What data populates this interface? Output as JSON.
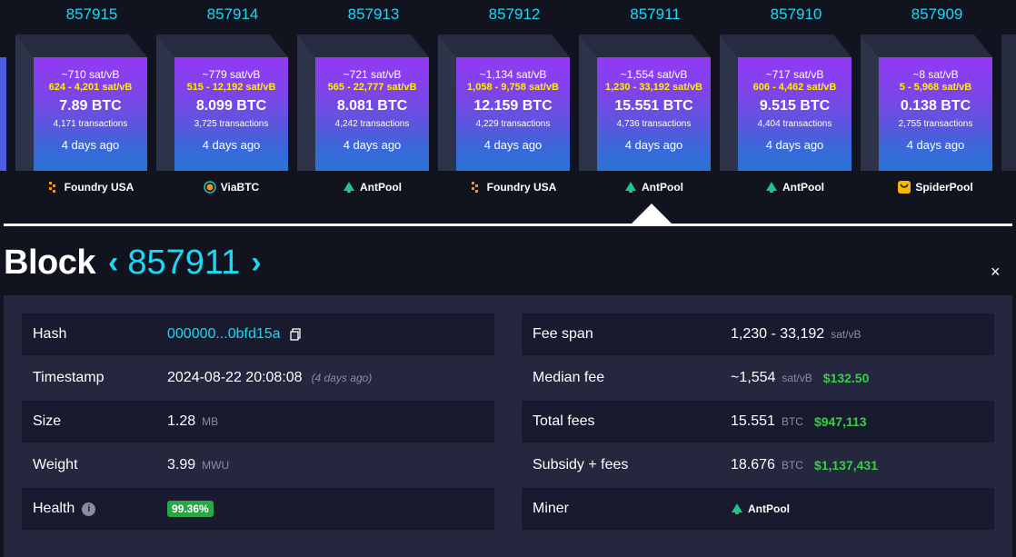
{
  "blocks": [
    {
      "height": "857915",
      "avg_fee": "~710 sat/vB",
      "fee_range": "624 - 4,201 sat/vB",
      "reward": "7.89 BTC",
      "tx_count": "4,171 transactions",
      "time_ago": "4 days ago",
      "miner": "Foundry USA",
      "miner_icon": "foundry-icon"
    },
    {
      "height": "857914",
      "avg_fee": "~779 sat/vB",
      "fee_range": "515 - 12,192 sat/vB",
      "reward": "8.099 BTC",
      "tx_count": "3,725 transactions",
      "time_ago": "4 days ago",
      "miner": "ViaBTC",
      "miner_icon": "viabtc-icon"
    },
    {
      "height": "857913",
      "avg_fee": "~721 sat/vB",
      "fee_range": "565 - 22,777 sat/vB",
      "reward": "8.081 BTC",
      "tx_count": "4,242 transactions",
      "time_ago": "4 days ago",
      "miner": "AntPool",
      "miner_icon": "antpool-icon"
    },
    {
      "height": "857912",
      "avg_fee": "~1,134 sat/vB",
      "fee_range": "1,058 - 9,758 sat/vB",
      "reward": "12.159 BTC",
      "tx_count": "4,229 transactions",
      "time_ago": "4 days ago",
      "miner": "Foundry USA",
      "miner_icon": "foundry-icon"
    },
    {
      "height": "857911",
      "avg_fee": "~1,554 sat/vB",
      "fee_range": "1,230 - 33,192 sat/vB",
      "reward": "15.551 BTC",
      "tx_count": "4,736 transactions",
      "time_ago": "4 days ago",
      "miner": "AntPool",
      "miner_icon": "antpool-icon"
    },
    {
      "height": "857910",
      "avg_fee": "~717 sat/vB",
      "fee_range": "606 - 4,462 sat/vB",
      "reward": "9.515 BTC",
      "tx_count": "4,404 transactions",
      "time_ago": "4 days ago",
      "miner": "AntPool",
      "miner_icon": "antpool-icon"
    },
    {
      "height": "857909",
      "avg_fee": "~8 sat/vB",
      "fee_range": "5 - 5,968 sat/vB",
      "reward": "0.138 BTC",
      "tx_count": "2,755 transactions",
      "time_ago": "4 days ago",
      "miner": "SpiderPool",
      "miner_icon": "spiderpool-icon"
    }
  ],
  "title": {
    "word": "Block",
    "number": "857911",
    "prev_icon": "chevron-left-icon",
    "next_icon": "chevron-right-icon"
  },
  "close_label": "×",
  "details": {
    "hash": {
      "label": "Hash",
      "value": "000000...0bfd15a",
      "copy_icon": "copy-icon"
    },
    "timestamp": {
      "label": "Timestamp",
      "value": "2024-08-22 20:08:08",
      "note": "(4 days ago)"
    },
    "size": {
      "label": "Size",
      "value": "1.28",
      "unit": "MB"
    },
    "weight": {
      "label": "Weight",
      "value": "3.99",
      "unit": "MWU"
    },
    "health": {
      "label": "Health",
      "value": "99.36%",
      "info_icon": "info-icon"
    },
    "fee_span": {
      "label": "Fee span",
      "value": "1,230 - 33,192",
      "unit": "sat/vB"
    },
    "median_fee": {
      "label": "Median fee",
      "value": "~1,554",
      "unit": "sat/vB",
      "usd": "$132.50"
    },
    "total_fees": {
      "label": "Total fees",
      "value": "15.551",
      "unit": "BTC",
      "usd": "$947,113"
    },
    "subsidy_fees": {
      "label": "Subsidy + fees",
      "value": "18.676",
      "unit": "BTC",
      "usd": "$1,137,431"
    },
    "miner": {
      "label": "Miner",
      "value": "AntPool",
      "icon": "antpool-icon"
    }
  },
  "colors": {
    "accent": "#1bd8f4",
    "fee_range": "#ffee00",
    "usd": "#3bcc49",
    "health": "#28a745",
    "background": "#11131f",
    "panel": "#24273e"
  }
}
